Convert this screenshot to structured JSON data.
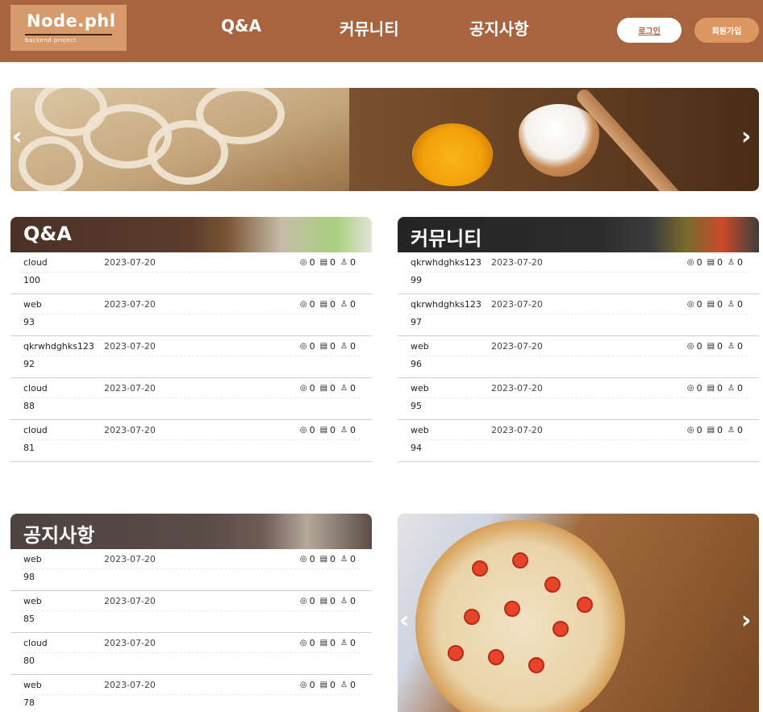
{
  "header": {
    "logo_title": "Node.phl",
    "logo_sub": "backend  project",
    "nav": [
      "Q&A",
      "커뮤니티",
      "공지사항"
    ],
    "login_label": "로그인",
    "join_label": "회원가입"
  },
  "slider": {
    "prev": "‹",
    "next": "›"
  },
  "boards": [
    {
      "title": "Q&A",
      "posts": [
        {
          "author": "cloud",
          "date": "2023-07-20",
          "views": "0",
          "comments": "0",
          "likes": "0",
          "num": "100"
        },
        {
          "author": "web",
          "date": "2023-07-20",
          "views": "0",
          "comments": "0",
          "likes": "0",
          "num": "93"
        },
        {
          "author": "qkrwhdghks123",
          "date": "2023-07-20",
          "views": "0",
          "comments": "0",
          "likes": "0",
          "num": "92"
        },
        {
          "author": "cloud",
          "date": "2023-07-20",
          "views": "0",
          "comments": "0",
          "likes": "0",
          "num": "88"
        },
        {
          "author": "cloud",
          "date": "2023-07-20",
          "views": "0",
          "comments": "0",
          "likes": "0",
          "num": "81"
        }
      ]
    },
    {
      "title": "커뮤니티",
      "posts": [
        {
          "author": "qkrwhdghks123",
          "date": "2023-07-20",
          "views": "0",
          "comments": "0",
          "likes": "0",
          "num": "99"
        },
        {
          "author": "qkrwhdghks123",
          "date": "2023-07-20",
          "views": "0",
          "comments": "0",
          "likes": "0",
          "num": "97"
        },
        {
          "author": "web",
          "date": "2023-07-20",
          "views": "0",
          "comments": "0",
          "likes": "0",
          "num": "96"
        },
        {
          "author": "web",
          "date": "2023-07-20",
          "views": "0",
          "comments": "0",
          "likes": "0",
          "num": "95"
        },
        {
          "author": "web",
          "date": "2023-07-20",
          "views": "0",
          "comments": "0",
          "likes": "0",
          "num": "94"
        }
      ]
    },
    {
      "title": "공지사항",
      "posts": [
        {
          "author": "web",
          "date": "2023-07-20",
          "views": "0",
          "comments": "0",
          "likes": "0",
          "num": "98"
        },
        {
          "author": "web",
          "date": "2023-07-20",
          "views": "0",
          "comments": "0",
          "likes": "0",
          "num": "85"
        },
        {
          "author": "cloud",
          "date": "2023-07-20",
          "views": "0",
          "comments": "0",
          "likes": "0",
          "num": "80"
        },
        {
          "author": "web",
          "date": "2023-07-20",
          "views": "0",
          "comments": "0",
          "likes": "0",
          "num": "78"
        }
      ]
    }
  ],
  "icons": {
    "views": "eye-icon",
    "comments": "comment-icon",
    "likes": "thumbs-up-icon"
  },
  "colors": {
    "header_bg": "#a8633f",
    "join_btn": "#dd9761"
  }
}
